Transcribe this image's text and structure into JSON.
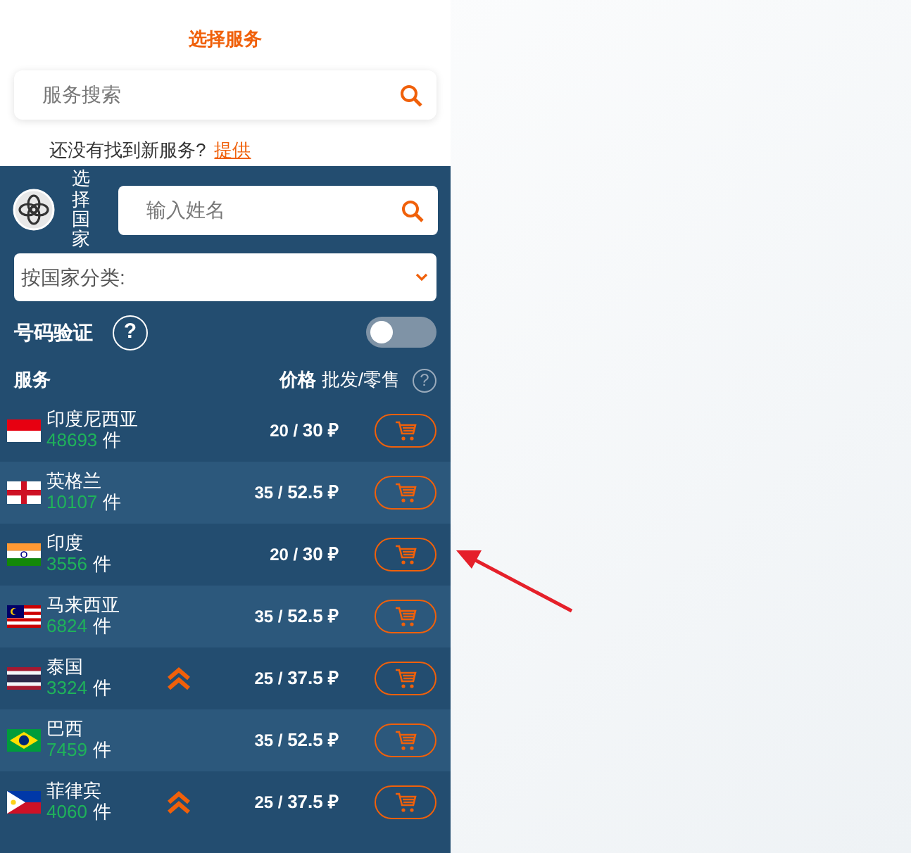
{
  "header": {
    "title": "选择服务"
  },
  "service_search": {
    "placeholder": "服务搜索"
  },
  "suggest": {
    "text": "还没有找到新服务?",
    "link": "提供"
  },
  "country": {
    "label": "选择国家",
    "search_placeholder": "输入姓名",
    "category_placeholder": "按国家分类:"
  },
  "verification": {
    "label": "号码验证",
    "help": "?",
    "on": false
  },
  "table": {
    "columns": [
      "服务",
      "价格",
      "批发/零售"
    ],
    "help": "?",
    "rows": [
      {
        "kind": "id",
        "name": "印度尼西亚",
        "count": "48693",
        "unit": "件",
        "boosted": false,
        "price": "20 / **30 ₽**"
      },
      {
        "kind": "gb",
        "name": "英格兰",
        "count": "10107",
        "unit": "件",
        "boosted": false,
        "price": "35 / **52.5 ₽**"
      },
      {
        "kind": "in",
        "name": "印度",
        "count": "3556",
        "unit": "件",
        "boosted": false,
        "price": "20 / **30 ₽**"
      },
      {
        "kind": "my",
        "name": "马来西亚",
        "count": "6824",
        "unit": "件",
        "boosted": false,
        "price": "35 / **52.5 ₽**"
      },
      {
        "kind": "th",
        "name": "泰国",
        "count": "3324",
        "unit": "件",
        "boosted": true,
        "price": "25 / **37.5 ₽**"
      },
      {
        "kind": "br",
        "name": "巴西",
        "count": "7459",
        "unit": "件",
        "boosted": false,
        "price": "35 / **52.5 ₽**"
      },
      {
        "kind": "ph",
        "name": "菲律宾",
        "count": "4060",
        "unit": "件",
        "boosted": true,
        "price": "25 / **37.5 ₽**"
      }
    ]
  }
}
